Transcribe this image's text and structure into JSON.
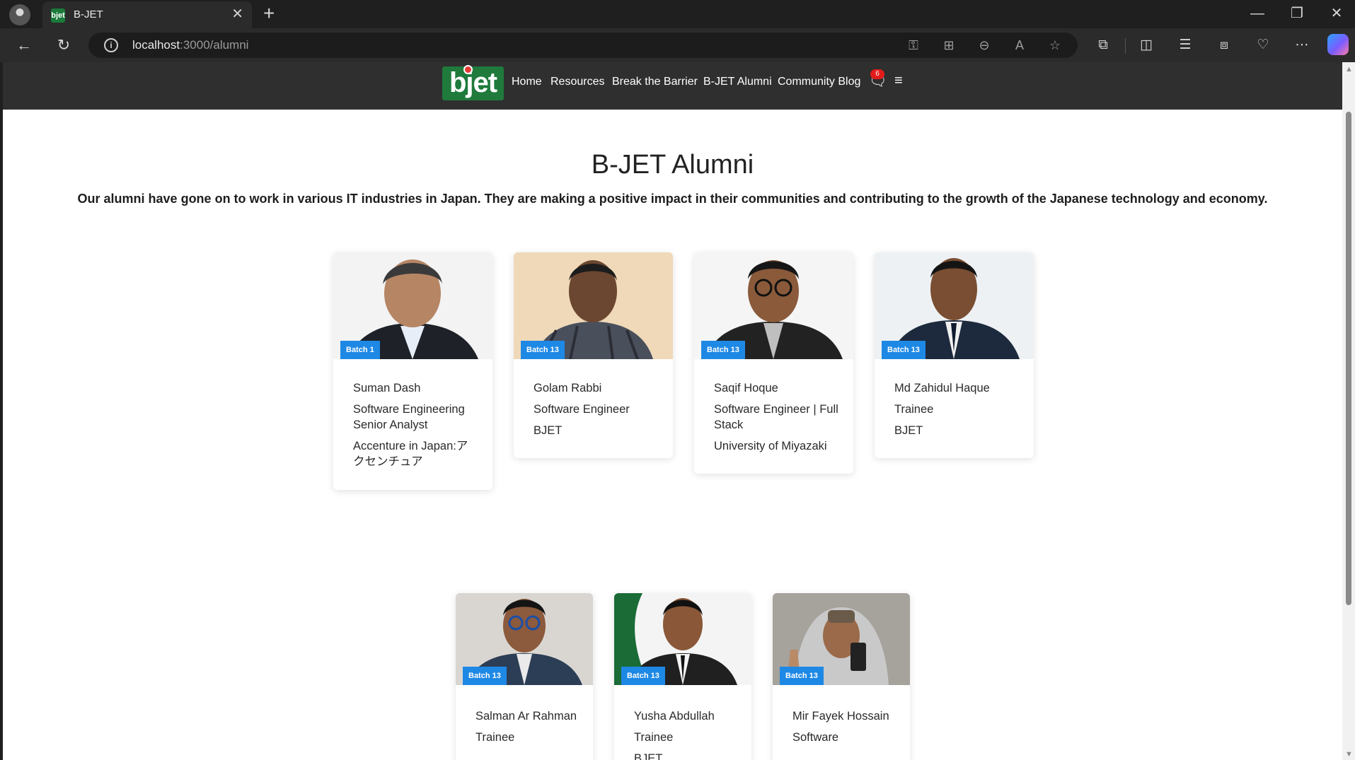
{
  "browser": {
    "tab_title": "B-JET",
    "favicon_text": "bjet",
    "url_host": "localhost",
    "url_path": ":3000/alumni"
  },
  "site": {
    "logo_text": "bjet",
    "nav": [
      "Home",
      "Resources",
      "Break the Barrier",
      "B-JET Alumni",
      "Community Blog"
    ],
    "notification_count": "6"
  },
  "page": {
    "title": "B-JET Alumni",
    "subtitle": "Our alumni have gone on to work in various IT industries in Japan. They are making a positive impact in their communities and contributing to the growth of the Japanese technology and economy."
  },
  "alumni": [
    {
      "batch": "Batch 1",
      "name": "Suman Dash",
      "role": "Software Engineering Senior Analyst",
      "company": "Accenture in Japan:アクセンチュア"
    },
    {
      "batch": "Batch 13",
      "name": "Golam Rabbi",
      "role": "Software Engineer",
      "company": "BJET"
    },
    {
      "batch": "Batch 13",
      "name": "Saqif Hoque",
      "role": "Software Engineer | Full Stack",
      "company": "University of Miyazaki"
    },
    {
      "batch": "Batch 13",
      "name": "Md Zahidul Haque",
      "role": "Trainee",
      "company": "BJET"
    },
    {
      "batch": "Batch 13",
      "name": "Salman Ar Rahman",
      "role": "Trainee",
      "company": ""
    },
    {
      "batch": "Batch 13",
      "name": "Yusha Abdullah",
      "role": "Trainee",
      "company": "BJET"
    },
    {
      "batch": "Batch 13",
      "name": "Mir Fayek Hossain",
      "role": "Software",
      "company": ""
    }
  ],
  "icons": {
    "chat": "chat-bubble-icon",
    "menu": "hamburger-menu-icon"
  }
}
